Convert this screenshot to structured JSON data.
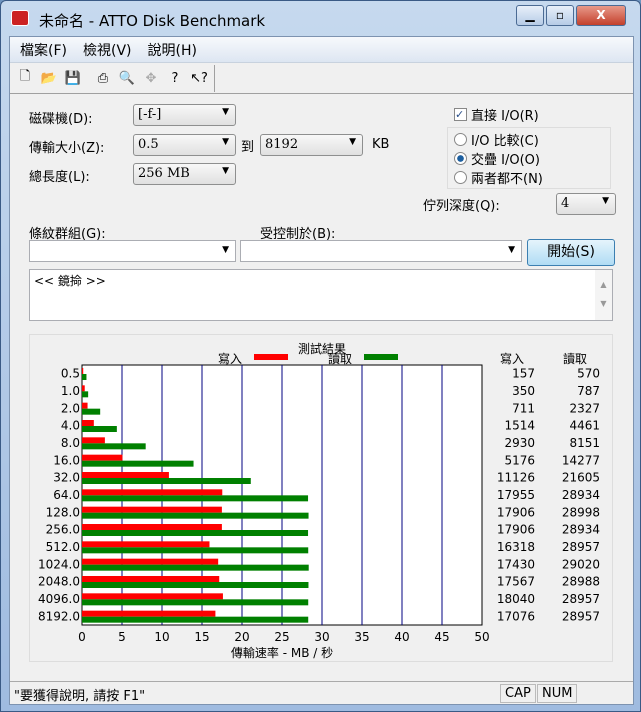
{
  "window": {
    "title": "未命名 - ATTO Disk Benchmark",
    "minimize": "▁",
    "maximize": "▫",
    "close": "X"
  },
  "menu": [
    "檔案(F)",
    "檢視(V)",
    "說明(H)"
  ],
  "toolbar": [
    "new-icon",
    "open-icon",
    "save-icon",
    "print-icon",
    "print-preview-icon",
    "move-icon",
    "help-icon",
    "context-help-icon"
  ],
  "form": {
    "drive_label": "磁碟機(D):",
    "drive_value": "[-f-]",
    "transfer_label": "傳輸大小(Z):",
    "transfer_from": "0.5",
    "to_label": "到",
    "transfer_to": "8192",
    "unit": "KB",
    "length_label": "總長度(L):",
    "length_value": "256 MB",
    "direct_io": "直接 I/O(R)",
    "direct_io_checked": true,
    "radio": [
      {
        "label": "I/O 比較(C)",
        "checked": false
      },
      {
        "label": "交疊 I/O(O)",
        "checked": true
      },
      {
        "label": "兩者都不(N)",
        "checked": false
      }
    ],
    "queue_label": "佇列深度(Q):",
    "queue_value": "4",
    "stripe_label": "條紋群組(G):",
    "stripe_value": "",
    "controlled_label": "受控制於(B):",
    "controlled_value": "",
    "start": "開始(S)",
    "description": "<< 鏡掵 >>"
  },
  "chart_data": {
    "type": "bar",
    "title": "測試結果",
    "xlabel": "傳輸速率 - MB / 秒",
    "xlim": [
      0,
      50
    ],
    "xticks": [
      "0",
      "5",
      "10",
      "15",
      "20",
      "25",
      "30",
      "35",
      "40",
      "45",
      "50"
    ],
    "categories": [
      "0.5",
      "1.0",
      "2.0",
      "4.0",
      "8.0",
      "16.0",
      "32.0",
      "64.0",
      "128.0",
      "256.0",
      "512.0",
      "1024.0",
      "2048.0",
      "4096.0",
      "8192.0"
    ],
    "series": [
      {
        "name": "寫入",
        "color": "#ff0000",
        "values": [
          157,
          350,
          711,
          1514,
          2930,
          5176,
          11126,
          17955,
          17906,
          17906,
          16318,
          17430,
          17567,
          18040,
          17076
        ]
      },
      {
        "name": "讀取",
        "color": "#008000",
        "values": [
          570,
          787,
          2327,
          4461,
          8151,
          14277,
          21605,
          28934,
          28998,
          28934,
          28957,
          29020,
          28988,
          28957,
          28957
        ]
      }
    ],
    "col_headers": [
      "寫入",
      "讀取"
    ]
  },
  "status": {
    "text": "\"要獲得說明, 請按 F1\"",
    "cap": "CAP",
    "num": "NUM"
  }
}
